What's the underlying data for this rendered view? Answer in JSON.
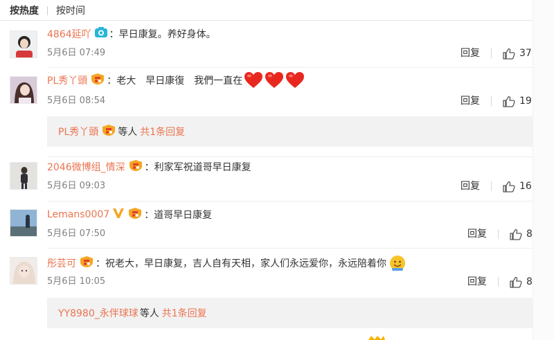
{
  "sort": {
    "by_hot": "按热度",
    "by_time": "按时间"
  },
  "comments": [
    {
      "user": "4864延吖",
      "badge_icon": "camera-icon",
      "text": "早日康复。养好身体。",
      "time": "5月6日 07:49",
      "reply_label": "回复",
      "likes": "37"
    },
    {
      "user": "PL秀丫頭",
      "badge_icon": "fan-badge-icon",
      "text": "老大　早日康復　我們一直在",
      "emoji": "heart-emoji",
      "time": "5月6日 08:54",
      "reply_label": "回复",
      "likes": "19",
      "subreply": {
        "user": "PL秀丫頭",
        "badge_icon": "fan-badge-icon",
        "middle": "等人",
        "link": "共1条回复"
      }
    },
    {
      "user": "2046微博组_情深",
      "badge_icon": "fan-badge-icon",
      "text": "利家军祝道哥早日康复",
      "time": "5月6日 09:03",
      "reply_label": "回复",
      "likes": "16"
    },
    {
      "user": "Lemans0007",
      "badge_icon": "verified-v-icon",
      "text": "道哥早日康复",
      "time": "5月6日 07:50",
      "reply_label": "回复",
      "likes": "8"
    },
    {
      "user": "彤芸可",
      "badge_icon": "fan-badge-icon",
      "text": "祝老大，早日康复，吉人自有天相，家人们永远爱你，永远陪着你",
      "emoji": "smile-emoji",
      "time": "5月6日 10:05",
      "reply_label": "回复",
      "likes": "8",
      "subreply": {
        "user": "YY8980_永伴球球",
        "middle": "等人",
        "link": "共1条回复"
      }
    }
  ],
  "colors": {
    "username": "#eb7350",
    "time": "#808080",
    "subreply_bg": "#f2f2f2",
    "heart": "#e8281f"
  }
}
